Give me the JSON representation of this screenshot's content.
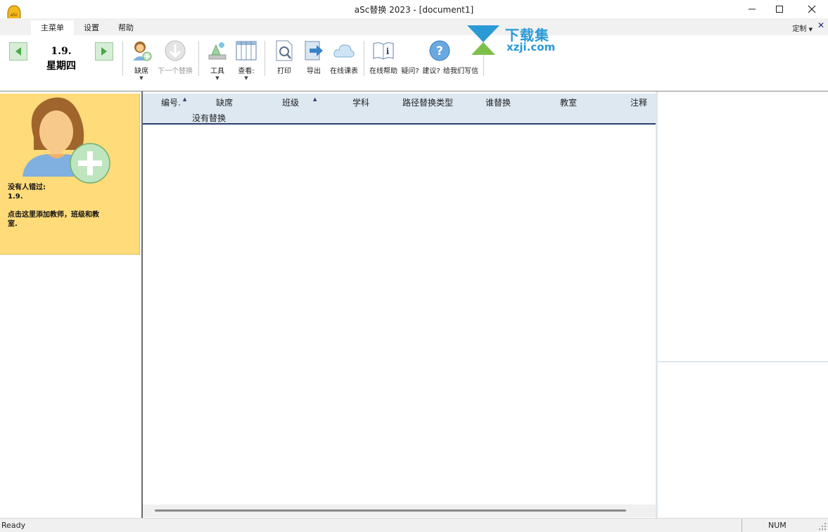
{
  "window": {
    "title": "aSc替换 2023  - [document1]",
    "logo_text": "aSc"
  },
  "tabs": [
    {
      "label": "主菜单",
      "active": true
    },
    {
      "label": "设置",
      "active": false
    },
    {
      "label": "帮助",
      "active": false
    }
  ],
  "tabbar": {
    "customize_label": "定制",
    "close_label": "✕"
  },
  "ribbon": {
    "date": "1.9.",
    "weekday": "星期四",
    "tools": {
      "absence": "缺席",
      "next_sub": "下一个替换",
      "tools": "工具",
      "view": "查看:",
      "print": "打印",
      "export": "导出",
      "online_timetable": "在线课表",
      "online_help": "在线帮助",
      "question": "疑问?",
      "suggest": "建议?",
      "write_us": "给我们写信"
    }
  },
  "watermark": {
    "top": "下载集",
    "bottom": "xzji.com"
  },
  "card": {
    "line1": "没有人错过:",
    "line2": "1.9.",
    "line3": "点击这里添加教师，班级和教",
    "line4": "室."
  },
  "grid": {
    "columns": [
      "编号.",
      "缺席",
      "班级",
      "学科",
      "路径替换类型",
      "谁替换",
      "教室",
      "注释"
    ],
    "sub_header": "没有替换"
  },
  "status": {
    "left": "Ready",
    "num": "NUM"
  },
  "colors": {
    "card_bg": "#ffdb7a",
    "header_bg": "#dde8f1",
    "accent": "#2c3e6e",
    "nav_green": "#d6eed6"
  }
}
